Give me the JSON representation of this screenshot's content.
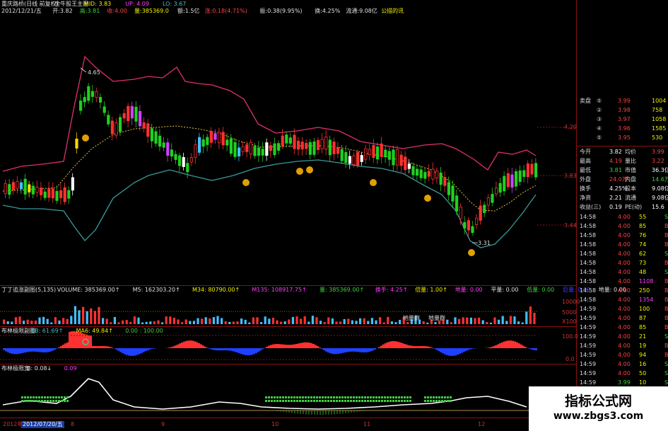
{
  "header": {
    "line1": [
      {
        "text": "重庆路桥(日线 前复权)",
        "color": "#e0e0e0"
      },
      {
        "text": "金牛股王主图",
        "color": "#e0e0e0"
      },
      {
        "text": "MID: 3.83",
        "color": "#f0f000"
      },
      {
        "text": "UP: 4.09",
        "color": "#ff3cff"
      },
      {
        "text": "LO: 3.67",
        "color": "#40c0c0"
      }
    ],
    "line2": [
      {
        "text": "2012/12/21/五",
        "color": "#e0e0e0"
      },
      {
        "text": "开:3.82",
        "color": "#e0e0e0"
      },
      {
        "text": "高:3.81",
        "color": "#40d040"
      },
      {
        "text": "收:4.00",
        "color": "#ff4040"
      },
      {
        "text": "量:385369.0",
        "color": "#f0f000"
      },
      {
        "text": "额:1.5亿",
        "color": "#e0e0e0"
      },
      {
        "text": "涨:0.18(4.71%)",
        "color": "#ff4040"
      },
      {
        "text": "振:0.38(9.95%)",
        "color": "#e0e0e0"
      },
      {
        "text": "换:4.25%",
        "color": "#e0e0e0"
      },
      {
        "text": "流通:9.08亿",
        "color": "#e0e0e0"
      },
      {
        "text": "公描的讯",
        "color": "#f0f000"
      }
    ]
  },
  "main_chart": {
    "price_high_label": "4.65",
    "price_low_label": "3.31",
    "y_ticks": [
      "4.20",
      "3.83",
      "3.44"
    ]
  },
  "volume_panel": {
    "header": [
      {
        "text": "丁丁追涨副图(5,135)",
        "color": "#e0e0e0"
      },
      {
        "text": "VOLUME: 385369.00↑",
        "color": "#e0e0e0"
      },
      {
        "text": "M5: 162303.20↑",
        "color": "#e0e0e0"
      },
      {
        "text": "M34: 80790.00↑",
        "color": "#f0f000"
      },
      {
        "text": "M135: 108917.75↑",
        "color": "#ff3cff"
      },
      {
        "text": "量: 385369.00↑",
        "color": "#40d040"
      },
      {
        "text": "换手: 4.25↑",
        "color": "#ff3cff"
      },
      {
        "text": "倍量: 1.00↑",
        "color": "#f0f000"
      },
      {
        "text": "地量: 0.00",
        "color": "#ff3cff"
      },
      {
        "text": "平量: 0.00",
        "color": "#e0e0e0"
      },
      {
        "text": "低量: 0.00",
        "color": "#40d040"
      },
      {
        "text": "巨量: 0.00",
        "color": "#4040ff"
      },
      {
        "text": "地量: 0.00",
        "color": "#e0e0e0"
      }
    ],
    "labels": [
      "地量群",
      "地量群"
    ],
    "y_ticks": [
      "10000",
      "5000",
      "X100"
    ]
  },
  "bb_panel": {
    "header": [
      {
        "text": "布林极限副图",
        "color": "#e0e0e0"
      },
      {
        "text": "BB: 61.69↑",
        "color": "#40c0c0"
      },
      {
        "text": "MA6: 49.84↑",
        "color": "#f0f000"
      },
      {
        "text": "0.00 : 100.00",
        "color": "#40d040"
      }
    ],
    "y_ticks": [
      "100.0",
      "0.0"
    ]
  },
  "width_panel": {
    "header": [
      {
        "text": "布林极限宽",
        "color": "#e0e0e0"
      },
      {
        "text": "B: 0.08↓",
        "color": "#e0e0e0"
      },
      {
        "text": "0.09",
        "color": "#ff3cff"
      }
    ]
  },
  "date_axis": {
    "cursor_date": "2012/07/20/五",
    "ticks": [
      "2012年",
      "8",
      "9",
      "10",
      "11",
      "12"
    ]
  },
  "quote": {
    "sell_rows": [
      {
        "label": "卖盘",
        "idx": "⑤",
        "price": "3.99",
        "vol": "1004"
      },
      {
        "label": "",
        "idx": "②",
        "price": "3.98",
        "vol": "758"
      },
      {
        "label": "",
        "idx": "③",
        "price": "3.97",
        "vol": "1058"
      },
      {
        "label": "",
        "idx": "④",
        "price": "3.96",
        "vol": "1585"
      },
      {
        "label": "",
        "idx": "⑤",
        "price": "3.95",
        "vol": "530"
      }
    ],
    "stats": [
      {
        "k1": "今开",
        "v1": "3.82",
        "c1": "#fff",
        "k2": "均价",
        "v2": "3.99",
        "c2": "#ff4040"
      },
      {
        "k1": "最高",
        "v1": "4.19",
        "c1": "#ff4040",
        "k2": "量比",
        "v2": "3.22",
        "c2": "#ff4040"
      },
      {
        "k1": "最低",
        "v1": "3.81",
        "c1": "#40d040",
        "k2": "市值",
        "v2": "36.3亿",
        "c2": "#fff"
      },
      {
        "k1": "外盘",
        "v1": "24.0万",
        "c1": "#ff4040",
        "k2": "内盘",
        "v2": "14.6万",
        "c2": "#40d040"
      },
      {
        "k1": "换手",
        "v1": "4.25%",
        "c1": "#fff",
        "k2": "股本",
        "v2": "9.08亿",
        "c2": "#fff"
      },
      {
        "k1": "净资",
        "v1": "2.21",
        "c1": "#fff",
        "k2": "流通",
        "v2": "9.08亿",
        "c2": "#fff"
      },
      {
        "k1": "收益(三)",
        "v1": "0.19",
        "c1": "#fff",
        "k2": "PE(动)",
        "v2": "15.6",
        "c2": "#fff"
      }
    ],
    "ticks": [
      {
        "time": "14:58",
        "price": "4.00",
        "vol": "55",
        "bs": "S"
      },
      {
        "time": "14:58",
        "price": "4.00",
        "vol": "85",
        "bs": "B"
      },
      {
        "time": "14:58",
        "price": "4.00",
        "vol": "76",
        "bs": "B"
      },
      {
        "time": "14:58",
        "price": "4.00",
        "vol": "74",
        "bs": "B"
      },
      {
        "time": "14:58",
        "price": "4.00",
        "vol": "62",
        "bs": "S"
      },
      {
        "time": "14:58",
        "price": "4.00",
        "vol": "73",
        "bs": "B"
      },
      {
        "time": "14:58",
        "price": "4.00",
        "vol": "48",
        "bs": "S"
      },
      {
        "time": "14:58",
        "price": "4.00",
        "vol": "1108",
        "bs": "B"
      },
      {
        "time": "14:58",
        "price": "4.00",
        "vol": "250",
        "bs": "B"
      },
      {
        "time": "14:58",
        "price": "4.00",
        "vol": "1354",
        "bs": "B"
      },
      {
        "time": "14:59",
        "price": "4.00",
        "vol": "100",
        "bs": "B"
      },
      {
        "time": "14:59",
        "price": "4.00",
        "vol": "87",
        "bs": "B"
      },
      {
        "time": "14:59",
        "price": "4.00",
        "vol": "85",
        "bs": "B"
      },
      {
        "time": "14:59",
        "price": "4.00",
        "vol": "21",
        "bs": "S"
      },
      {
        "time": "14:59",
        "price": "4.00",
        "vol": "19",
        "bs": "B"
      },
      {
        "time": "14:59",
        "price": "4.00",
        "vol": "94",
        "bs": "B"
      },
      {
        "time": "14:59",
        "price": "4.00",
        "vol": "16",
        "bs": "S"
      },
      {
        "time": "14:59",
        "price": "4.00",
        "vol": "50",
        "bs": "S"
      },
      {
        "time": "14:59",
        "price": "3.99",
        "vol": "10",
        "bs": "S"
      },
      {
        "time": "14:59",
        "price": "3.99",
        "vol": "120",
        "bs": "S"
      },
      {
        "time": "14:59",
        "price": "4.00",
        "vol": "163",
        "bs": "B"
      },
      {
        "time": "15:00",
        "price": "4.00",
        "vol": "3",
        "bs": "B"
      }
    ]
  },
  "watermark": {
    "line1": "指标公式网",
    "line2": "www.zbgs3.com"
  },
  "colors": {
    "up": "#ff3030",
    "down": "#20d020",
    "band_upper": "#e0306a",
    "band_lower": "#3a9a9a",
    "mid": "#e8c040"
  }
}
